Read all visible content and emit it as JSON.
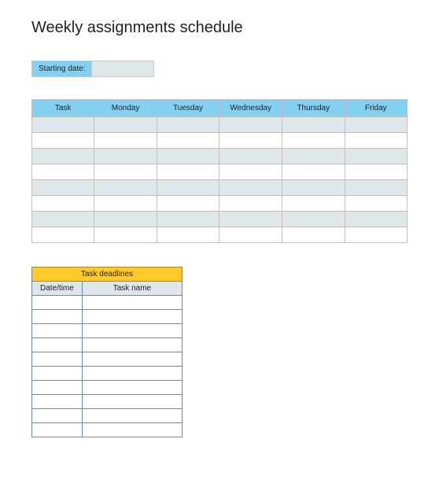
{
  "title": "Weekly assignments schedule",
  "starting_date": {
    "label": "Starting date:",
    "value": ""
  },
  "schedule": {
    "headers": [
      "Task",
      "Monday",
      "Tuesday",
      "Wednesday",
      "Thursday",
      "Friday"
    ],
    "rows": [
      [
        "",
        "",
        "",
        "",
        "",
        ""
      ],
      [
        "",
        "",
        "",
        "",
        "",
        ""
      ],
      [
        "",
        "",
        "",
        "",
        "",
        ""
      ],
      [
        "",
        "",
        "",
        "",
        "",
        ""
      ],
      [
        "",
        "",
        "",
        "",
        "",
        ""
      ],
      [
        "",
        "",
        "",
        "",
        "",
        ""
      ],
      [
        "",
        "",
        "",
        "",
        "",
        ""
      ],
      [
        "",
        "",
        "",
        "",
        "",
        ""
      ]
    ]
  },
  "deadlines": {
    "title": "Task deadlines",
    "headers": [
      "Date/time",
      "Task name"
    ],
    "rows": [
      [
        "",
        ""
      ],
      [
        "",
        ""
      ],
      [
        "",
        ""
      ],
      [
        "",
        ""
      ],
      [
        "",
        ""
      ],
      [
        "",
        ""
      ],
      [
        "",
        ""
      ],
      [
        "",
        ""
      ],
      [
        "",
        ""
      ],
      [
        "",
        ""
      ]
    ]
  }
}
